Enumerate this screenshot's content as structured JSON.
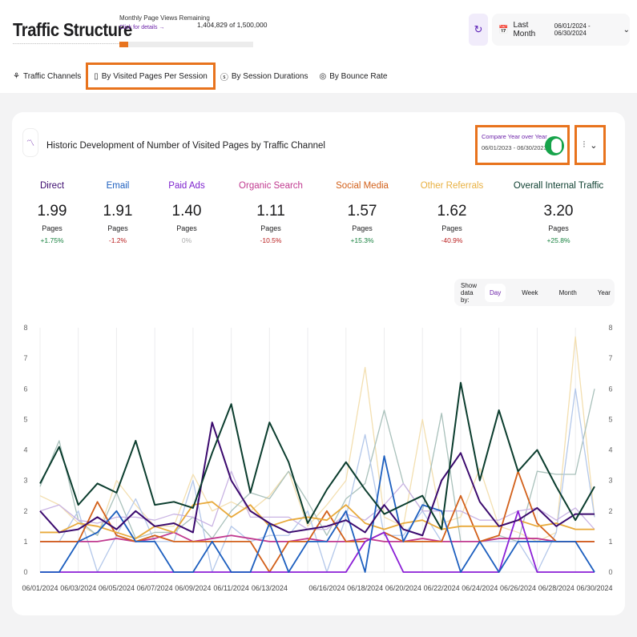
{
  "header": {
    "title": "Traffic Structure",
    "pv_label": "Monthly Page Views Remaining",
    "pv_link": "Click for details →",
    "pv_count": "1,404,829 of 1,500,000",
    "pv_used_fraction": 0.0635,
    "range_label": "Last Month",
    "range_dates": "06/01/2024 - 06/30/2024"
  },
  "tabs": [
    {
      "label": "Traffic Channels",
      "icon": "network-icon"
    },
    {
      "label": "By Visited Pages Per Session",
      "icon": "pages-icon",
      "active": true
    },
    {
      "label": "By Session Durations",
      "icon": "timer-icon"
    },
    {
      "label": "By Bounce Rate",
      "icon": "target-icon"
    }
  ],
  "card": {
    "title": "Historic Development of Number of Visited Pages by Traffic Channel",
    "yoy_label": "Compare Year over Year",
    "yoy_dates": "06/01/2023 - 06/30/2023",
    "yoy_on": true
  },
  "metrics": [
    {
      "name": "Direct",
      "value": "1.99",
      "unit": "Pages",
      "change": "+1.75%",
      "color": "#3b0a6e",
      "change_color": "#15803d"
    },
    {
      "name": "Email",
      "value": "1.91",
      "unit": "Pages",
      "change": "-1.2%",
      "color": "#1d5fbf",
      "change_color": "#b91c1c"
    },
    {
      "name": "Paid Ads",
      "value": "1.40",
      "unit": "Pages",
      "change": "0%",
      "color": "#7e22ce",
      "change_color": "#aaaaaa"
    },
    {
      "name": "Organic Search",
      "value": "1.11",
      "unit": "Pages",
      "change": "-10.5%",
      "color": "#c0398f",
      "change_color": "#b91c1c"
    },
    {
      "name": "Social Media",
      "value": "1.57",
      "unit": "Pages",
      "change": "+15.3%",
      "color": "#d2601a",
      "change_color": "#15803d"
    },
    {
      "name": "Other Referrals",
      "value": "1.62",
      "unit": "Pages",
      "change": "-40.9%",
      "color": "#e8b040",
      "change_color": "#b91c1c"
    },
    {
      "name": "Overall Internal Traffic",
      "value": "3.20",
      "unit": "Pages",
      "change": "+25.8%",
      "color": "#0b3d2e",
      "change_color": "#15803d"
    }
  ],
  "showby": {
    "label": "Show data by:",
    "options": [
      "Day",
      "Week",
      "Month",
      "Year"
    ],
    "selected": "Day"
  },
  "chart_data": {
    "type": "line",
    "ylim": [
      0,
      8
    ],
    "yticks": [
      "0",
      "1",
      "2",
      "3",
      "4",
      "5",
      "6",
      "7",
      "8"
    ],
    "xticks": [
      "06/01/2024",
      "06/03/2024",
      "06/05/2024",
      "06/07/2024",
      "06/09/2024",
      "06/11/2024",
      "06/13/2024",
      "06/16/2024",
      "06/18/2024",
      "06/20/2024",
      "06/22/2024",
      "06/24/2024",
      "06/26/2024",
      "06/28/2024",
      "06/30/2024"
    ],
    "x_days": 30,
    "grid": true,
    "series": [
      {
        "name": "Other Referrals",
        "period": "2023",
        "color": "#f3dfb0",
        "values": [
          2.5,
          2.2,
          1.6,
          1.2,
          3.0,
          2.2,
          1.5,
          1.5,
          3.2,
          2.0,
          2.3,
          2.0,
          2.5,
          3.3,
          1.5,
          2.2,
          3.0,
          6.7,
          1.8,
          1.5,
          5.0,
          1.6,
          1.8,
          3.4,
          1.5,
          1.3,
          1.0,
          1.3,
          7.7,
          1.8
        ]
      },
      {
        "name": "Overall Internal Traffic",
        "period": "2023",
        "color": "#a9c1bb",
        "values": [
          2.8,
          4.3,
          1.7,
          1.2,
          2.6,
          1.1,
          1.3,
          1.3,
          1.8,
          1.1,
          2.0,
          2.6,
          2.4,
          3.3,
          2.3,
          1.2,
          2.4,
          2.9,
          5.3,
          2.9,
          2.0,
          5.2,
          1.0,
          1.0,
          1.2,
          1.0,
          3.3,
          3.2,
          3.2,
          6.0
        ]
      },
      {
        "name": "Email",
        "period": "2023",
        "color": "#b4c8ea",
        "values": [
          1.0,
          1.0,
          2.0,
          0,
          1.2,
          2.4,
          1.0,
          1.0,
          3.0,
          0,
          1.5,
          1.0,
          1.2,
          1.2,
          2.0,
          0,
          1.8,
          4.5,
          1.2,
          1.2,
          2.0,
          1.0,
          1.0,
          1.0,
          1.0,
          1.0,
          0,
          1.3,
          6.0,
          1.8
        ]
      },
      {
        "name": "Direct",
        "period": "2023",
        "color": "#c9b3e3",
        "values": [
          2.0,
          2.2,
          1.7,
          1.6,
          1.8,
          1.8,
          1.7,
          1.9,
          1.8,
          1.5,
          3.3,
          1.8,
          1.8,
          1.8,
          1.4,
          1.4,
          1.9,
          1.7,
          2.2,
          2.9,
          2.0,
          2.0,
          2.0,
          1.7,
          1.7,
          2.0,
          2.1,
          1.7,
          2.1,
          1.4
        ]
      },
      {
        "name": "Organic Search",
        "color": "#c0398f",
        "values": [
          1.0,
          1.0,
          1.0,
          1.0,
          1.1,
          1.0,
          1.1,
          1.3,
          1.0,
          1.1,
          1.2,
          1.1,
          1.0,
          1.0,
          1.1,
          1.0,
          1.0,
          1.1,
          1.0,
          1.0,
          1.1,
          1.0,
          1.0,
          1.0,
          1.1,
          1.1,
          1.1,
          1.0,
          1.0,
          1.0
        ]
      },
      {
        "name": "Social Media",
        "color": "#d2601a",
        "values": [
          1.0,
          1.0,
          1.0,
          2.3,
          1.2,
          1.0,
          1.2,
          1.0,
          1.0,
          1.0,
          1.0,
          1.0,
          0,
          1.0,
          1.0,
          2.0,
          1.0,
          1.0,
          1.3,
          1.0,
          1.0,
          1.0,
          2.5,
          1.0,
          1.2,
          3.3,
          1.6,
          1.0,
          1.0,
          1.0
        ]
      },
      {
        "name": "Other Referrals",
        "color": "#e8a93a",
        "values": [
          1.3,
          1.3,
          1.6,
          1.5,
          1.3,
          1.1,
          1.5,
          1.3,
          2.2,
          2.3,
          1.8,
          2.2,
          1.5,
          1.7,
          1.8,
          1.7,
          2.2,
          1.6,
          1.4,
          1.6,
          1.7,
          1.4,
          1.5,
          1.5,
          1.5,
          1.7,
          1.5,
          1.6,
          1.4,
          1.4
        ]
      },
      {
        "name": "Paid Ads",
        "color": "#8b1fd6",
        "values": [
          0,
          0,
          0,
          0,
          0,
          0,
          0,
          0,
          0,
          0,
          0,
          0,
          0,
          0,
          0,
          0,
          0,
          1.0,
          1.3,
          0,
          0,
          0,
          0,
          0,
          0,
          2.0,
          0,
          0,
          0,
          0
        ]
      },
      {
        "name": "Email",
        "color": "#1d5fbf",
        "values": [
          0,
          0,
          1.0,
          1.3,
          2.0,
          1.0,
          1.0,
          0,
          0,
          1.0,
          0,
          0,
          1.6,
          0,
          1.0,
          1.0,
          2.0,
          0,
          3.8,
          1.0,
          2.2,
          2.0,
          0,
          1.0,
          0,
          1.0,
          1.0,
          1.0,
          1.0,
          0
        ]
      },
      {
        "name": "Direct",
        "color": "#3b0a6e",
        "values": [
          2.0,
          1.3,
          1.4,
          1.8,
          1.4,
          2.0,
          1.5,
          1.6,
          1.3,
          4.9,
          3.0,
          2.0,
          1.6,
          1.3,
          1.4,
          1.5,
          1.7,
          1.3,
          2.2,
          1.4,
          1.2,
          3.0,
          3.9,
          2.3,
          1.5,
          1.7,
          2.1,
          1.5,
          1.9,
          1.9
        ]
      },
      {
        "name": "Overall Internal Traffic",
        "color": "#0b3d2e",
        "values": [
          2.9,
          4.1,
          2.2,
          2.9,
          2.6,
          4.3,
          2.2,
          2.3,
          2.1,
          3.9,
          5.5,
          2.6,
          4.9,
          3.6,
          1.6,
          2.7,
          3.6,
          2.7,
          1.9,
          2.2,
          2.5,
          1.4,
          6.2,
          3.0,
          5.3,
          3.3,
          4.0,
          2.8,
          1.7,
          2.8
        ]
      }
    ]
  }
}
